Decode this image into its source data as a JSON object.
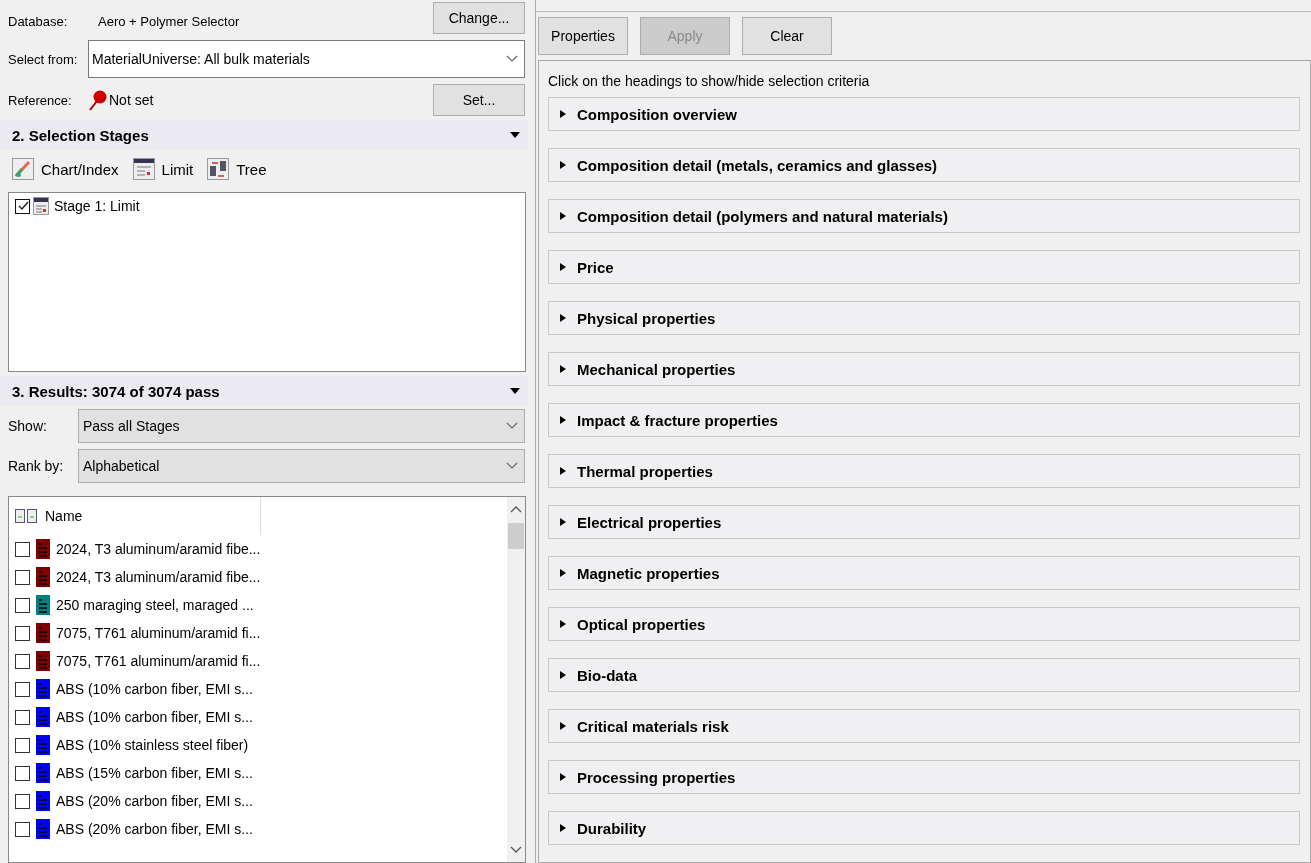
{
  "database": {
    "label": "Database:",
    "value": "Aero + Polymer Selector",
    "button": "Change..."
  },
  "select_from": {
    "label": "Select from:",
    "value": "MaterialUniverse: All bulk materials"
  },
  "reference": {
    "label": "Reference:",
    "value": "Not set",
    "button": "Set..."
  },
  "selection_stages": {
    "title": "2. Selection Stages",
    "tools": [
      {
        "label": "Chart/Index",
        "kind": "chart"
      },
      {
        "label": "Limit",
        "kind": "limit"
      },
      {
        "label": "Tree",
        "kind": "tree"
      }
    ],
    "stages": [
      {
        "label": "Stage 1: Limit",
        "checked": true
      }
    ]
  },
  "results": {
    "title": "3. Results: 3074 of 3074 pass",
    "show_label": "Show:",
    "show_value": "Pass all Stages",
    "rank_label": "Rank by:",
    "rank_value": "Alphabetical",
    "column": "Name",
    "rows": [
      {
        "name": "2024, T3 aluminum/aramid fibe...",
        "checked": false,
        "color": "#800000"
      },
      {
        "name": "2024, T3 aluminum/aramid fibe...",
        "checked": false,
        "color": "#800000"
      },
      {
        "name": "250 maraging steel, maraged ...",
        "checked": false,
        "color": "#008080"
      },
      {
        "name": "7075, T761 aluminum/aramid fi...",
        "checked": false,
        "color": "#800000"
      },
      {
        "name": "7075, T761 aluminum/aramid fi...",
        "checked": false,
        "color": "#800000"
      },
      {
        "name": "ABS (10% carbon fiber, EMI s...",
        "checked": false,
        "color": "#0000ff"
      },
      {
        "name": "ABS (10% carbon fiber, EMI s...",
        "checked": false,
        "color": "#0000ff"
      },
      {
        "name": "ABS (10% stainless steel fiber)",
        "checked": false,
        "color": "#0000ff"
      },
      {
        "name": "ABS (15% carbon fiber, EMI s...",
        "checked": false,
        "color": "#0000ff"
      },
      {
        "name": "ABS (20% carbon fiber, EMI s...",
        "checked": false,
        "color": "#0000ff"
      },
      {
        "name": "ABS (20% carbon fiber, EMI s...",
        "checked": false,
        "color": "#0000ff"
      }
    ]
  },
  "toolbar": [
    {
      "label": "Properties",
      "disabled": false
    },
    {
      "label": "Apply",
      "disabled": true
    },
    {
      "label": "Clear",
      "disabled": false
    }
  ],
  "hint": "Click on the headings to show/hide selection criteria",
  "sections": [
    {
      "title": "Composition overview",
      "expanded": false
    },
    {
      "title": "Composition detail (metals, ceramics and glasses)",
      "expanded": false
    },
    {
      "title": "Composition detail (polymers and natural materials)",
      "expanded": false
    },
    {
      "title": "Price",
      "expanded": false
    },
    {
      "title": "Physical properties",
      "expanded": false
    },
    {
      "title": "Mechanical properties",
      "expanded": false
    },
    {
      "title": "Impact & fracture properties",
      "expanded": false
    },
    {
      "title": "Thermal properties",
      "expanded": false
    },
    {
      "title": "Electrical properties",
      "expanded": false
    },
    {
      "title": "Magnetic properties",
      "expanded": false
    },
    {
      "title": "Optical properties",
      "expanded": false
    },
    {
      "title": "Bio-data",
      "expanded": false
    },
    {
      "title": "Critical materials risk",
      "expanded": false
    },
    {
      "title": "Processing properties",
      "expanded": false
    },
    {
      "title": "Durability",
      "expanded": false
    }
  ]
}
